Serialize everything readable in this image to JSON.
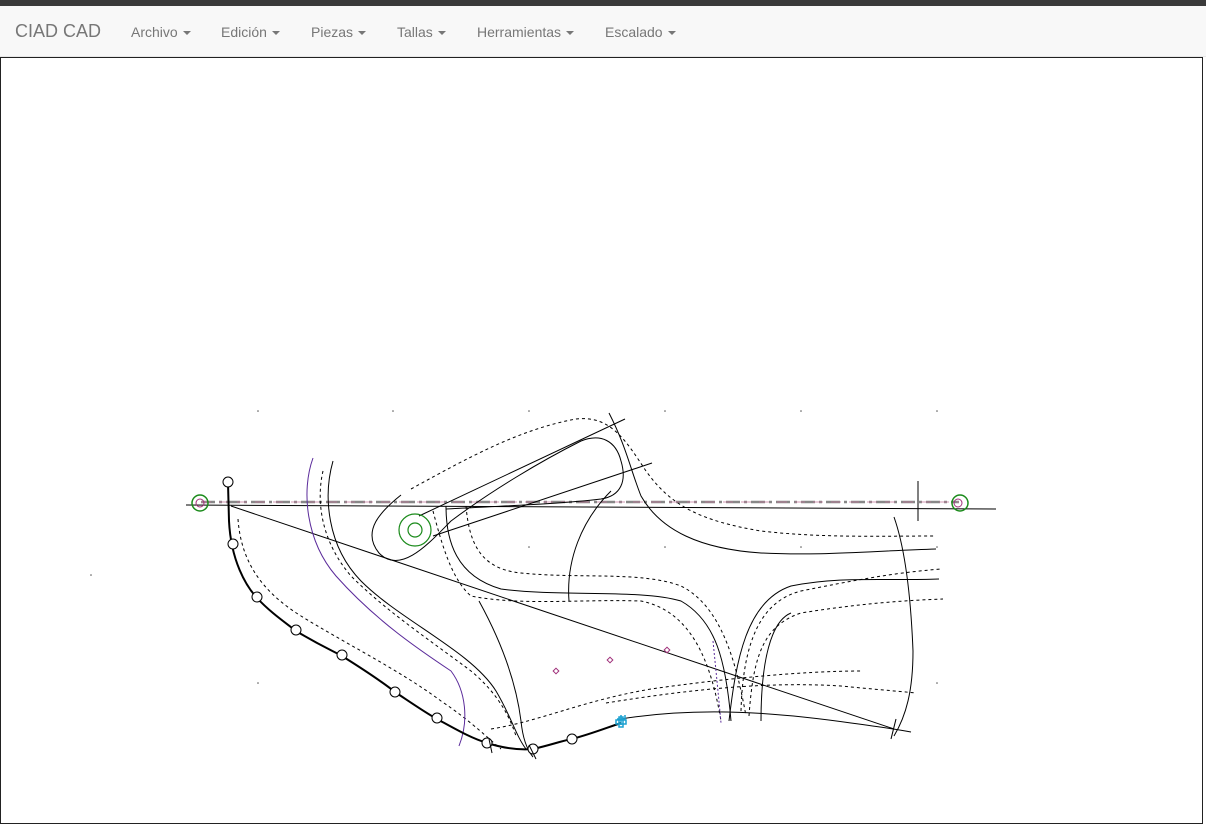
{
  "app": {
    "brand": "CIAD CAD"
  },
  "menu": {
    "items": [
      {
        "label": "Archivo"
      },
      {
        "label": "Edición"
      },
      {
        "label": "Piezas"
      },
      {
        "label": "Tallas"
      },
      {
        "label": "Herramientas"
      },
      {
        "label": "Escalado"
      }
    ]
  },
  "colors": {
    "navbar_bg": "#f8f8f8",
    "nav_text": "#777777",
    "line": "#000000",
    "center_line": "#888888",
    "accent_green": "#1a8a1a",
    "accent_purple": "#5a2a9a",
    "marker_magenta": "#a0307a",
    "cursor_cyan": "#1aa0d0"
  },
  "icons": {
    "dropdown": "caret-down-icon",
    "cursor": "crosshair-cursor-icon"
  }
}
